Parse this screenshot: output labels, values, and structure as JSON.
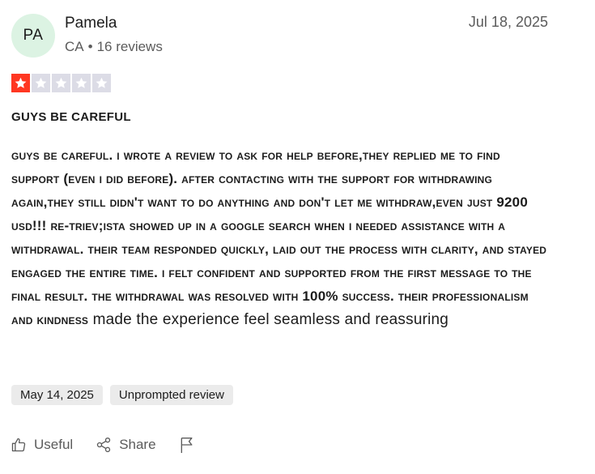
{
  "review": {
    "avatar_initials": "PA",
    "reviewer_name": "Pamela",
    "country": "CA",
    "separator": "•",
    "review_count": "16 reviews",
    "date": "Jul 18, 2025",
    "rating": 1,
    "rating_max": 5,
    "title": "GUYS BE CAREFUL",
    "body_caps": "GUYS BE CAREFUL. I WROTE A REVIEW TO ASK FOR HELP BEFORE,THEY REPLIED ME TO FIND SUPPORT (EVEN I DID BEFORE). AFTER CONTACTING WITH THE SUPPORT FOR WITHDRAWING AGAIN,THEY STILL DIDN'T WANT TO DO ANYTHING AND DON'T LET ME WITHDRAW,EVEN JUST 9200 USD!!! RE-TRIEV;ISTA SHOWED UP IN A GOOGLE SEARCH WHEN I NEEDED ASSISTANCE WITH A WITHDRAWAL. THEIR TEAM RESPONDED QUICKLY, LAID OUT THE PROCESS WITH CLARITY, AND STAYED ENGAGED THE ENTIRE TIME. I FELT CONFIDENT AND SUPPORTED FROM THE FIRST MESSAGE TO THE FINAL RESULT. THE WITHDRAWAL WAS RESOLVED WITH 100% SUCCESS. THEIR PROFESSIONALISM AND KINDNESS",
    "body_tail": " made the experience feel seamless and reassuring",
    "tags": [
      "May 14, 2025",
      "Unprompted review"
    ]
  },
  "actions": {
    "useful_label": "Useful",
    "share_label": "Share"
  },
  "icons": {
    "star": "star-icon",
    "useful": "thumbs-up-icon",
    "share": "share-icon",
    "flag": "flag-icon"
  },
  "colors": {
    "star_filled": "#ff3722",
    "star_empty": "#dcdce6",
    "avatar_bg": "#dcf3e3",
    "tag_bg": "#ebebeb"
  }
}
